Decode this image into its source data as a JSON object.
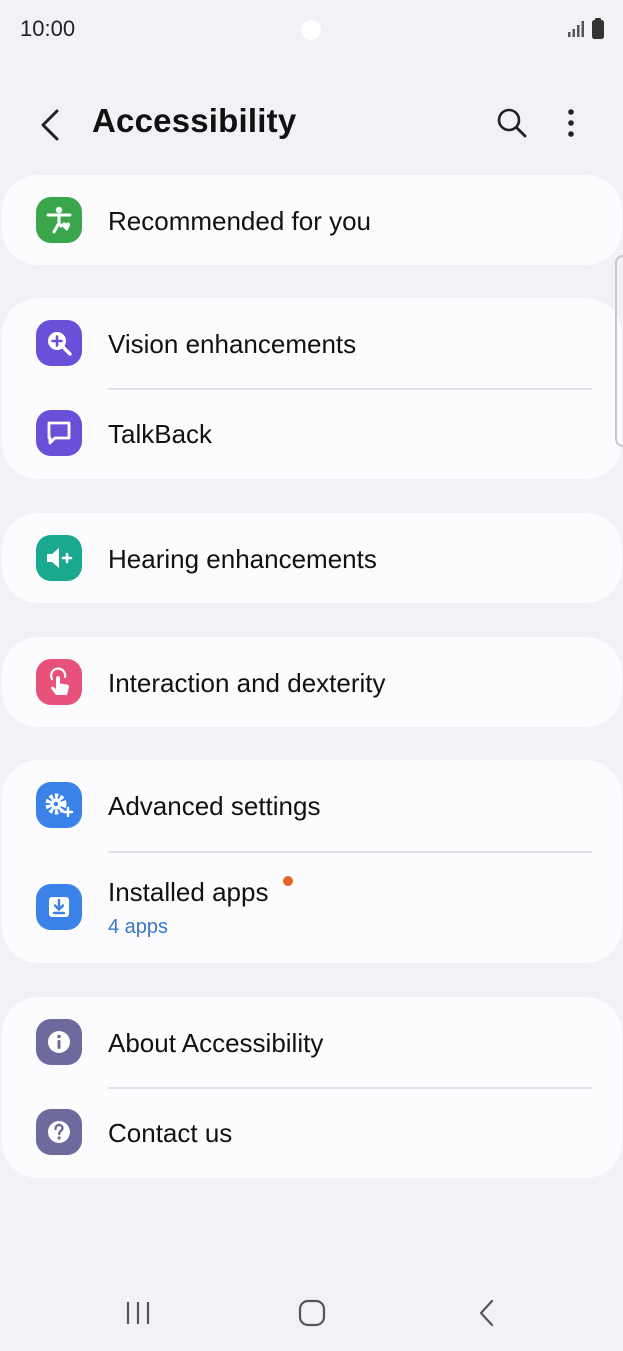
{
  "status_bar": {
    "time": "10:00",
    "signal_icon": "signal-icon",
    "battery_icon": "battery-icon"
  },
  "app_bar": {
    "title": "Accessibility",
    "back_icon": "back-arrow-icon",
    "search_icon": "search-icon",
    "more_icon": "more-vert-icon"
  },
  "menu": {
    "recommended": {
      "label": "Recommended for you",
      "icon": "accessibility-person-icon",
      "color": "#3aa54a"
    },
    "vision": {
      "label": "Vision enhancements",
      "icon": "zoom-in-icon",
      "color": "#6a4fd8"
    },
    "talkback": {
      "label": "TalkBack",
      "icon": "chat-bubble-icon",
      "color": "#6a4fd8"
    },
    "hearing": {
      "label": "Hearing enhancements",
      "icon": "volume-plus-icon",
      "color": "#1aa88e"
    },
    "interaction": {
      "label": "Interaction and dexterity",
      "icon": "touch-hand-icon",
      "color": "#e8527a"
    },
    "advanced": {
      "label": "Advanced settings",
      "icon": "gear-plus-icon",
      "color": "#3b82e8"
    },
    "installed": {
      "label": "Installed apps",
      "sub": "4 apps",
      "icon": "download-icon",
      "color": "#3b82e8",
      "badge_color": "#e5632a"
    },
    "about": {
      "label": "About Accessibility",
      "icon": "info-icon",
      "color": "#6e6a9e"
    },
    "contact": {
      "label": "Contact us",
      "icon": "help-icon",
      "color": "#6e6a9e"
    }
  },
  "nav_bar": {
    "recents_icon": "recents-icon",
    "home_icon": "home-icon",
    "back_icon": "nav-back-icon"
  }
}
